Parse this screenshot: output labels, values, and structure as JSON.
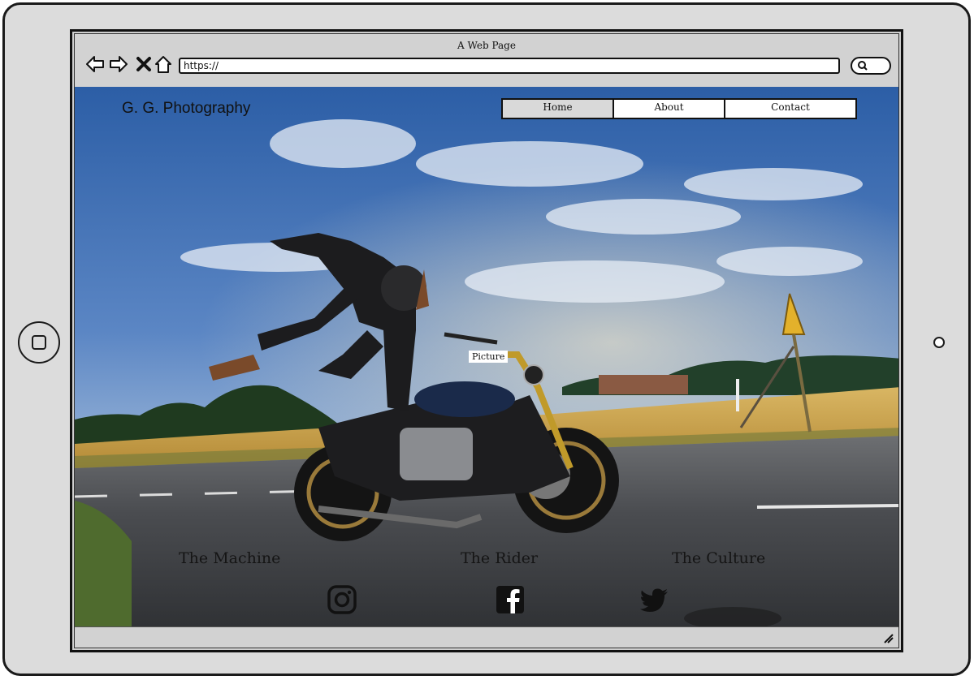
{
  "window": {
    "title": "A Web Page"
  },
  "address_bar": {
    "url": "https://"
  },
  "site": {
    "brand": "G. G. Photography",
    "nav": [
      {
        "label": "Home",
        "active": true
      },
      {
        "label": "About",
        "active": false
      },
      {
        "label": "Contact",
        "active": false
      }
    ],
    "hero": {
      "picture_label": "Picture"
    },
    "sections": [
      "The Machine",
      "The Rider",
      "The Culture"
    ],
    "social": [
      "instagram-icon",
      "facebook-icon",
      "twitter-icon"
    ]
  },
  "browser_icons": [
    "back-arrow-icon",
    "forward-arrow-icon",
    "close-x-icon",
    "home-icon",
    "search-icon"
  ],
  "colors": {
    "frame": "#dcdcdc",
    "browser_chrome": "#d2d2d2",
    "sky": "#3a6fb0",
    "field": "#c9a24a",
    "road": "#3b3d40"
  }
}
